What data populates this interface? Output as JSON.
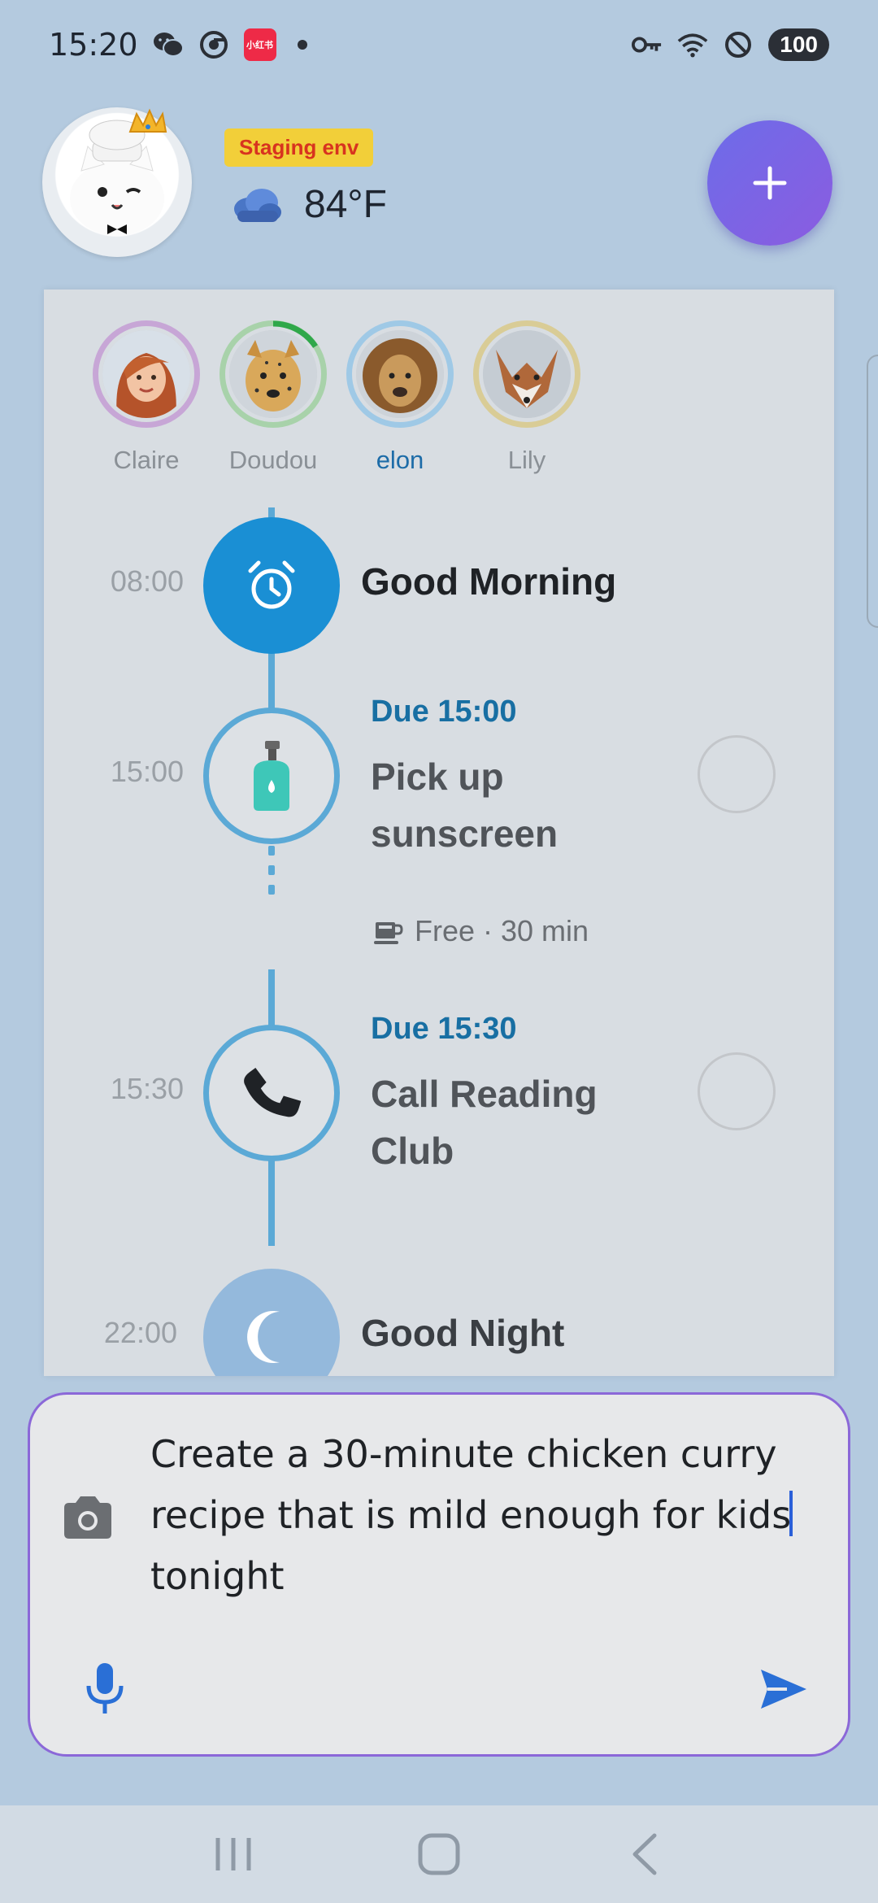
{
  "status_bar": {
    "time": "15:20",
    "battery": "100",
    "notification_icons": [
      "wechat-icon",
      "chrome-icon",
      "xiaohongshu-icon"
    ],
    "xhs_label": "小红书"
  },
  "header": {
    "env_badge": "Staging env",
    "temperature": "84°F",
    "weather_icon": "cloud-icon",
    "add_label": "+"
  },
  "people": [
    {
      "name": "Claire",
      "ring_color": "#c7a6d6",
      "active": false
    },
    {
      "name": "Doudou",
      "ring_color": "#a8d2aa",
      "active": false,
      "progress_arc_color": "#2fa84a"
    },
    {
      "name": "elon",
      "ring_color": "#9fc9e6",
      "active": true
    },
    {
      "name": "Lily",
      "ring_color": "#d9cc96",
      "active": false
    }
  ],
  "timeline": {
    "morning": {
      "time": "08:00",
      "title": "Good Morning",
      "icon": "alarm-clock-icon"
    },
    "tasks": [
      {
        "time": "15:00",
        "due": "Due 15:00",
        "title": "Pick up sunscreen",
        "icon": "lotion-bottle-icon"
      },
      {
        "time": "15:30",
        "due": "Due 15:30",
        "title": "Call  Reading Club",
        "icon": "phone-icon"
      }
    ],
    "free": {
      "text": "Free · 30 min",
      "icon": "coffee-cup-icon"
    },
    "night": {
      "time": "22:00",
      "title": "Good Night",
      "icon": "moon-icon"
    }
  },
  "composer": {
    "text_before_caret": "Create a 30-minute chicken curry recipe that is mild enough for kids",
    "text_after_caret": "tonight"
  },
  "colors": {
    "accent_blue": "#1a8fd4",
    "timeline_blue": "#5ba9d6",
    "fab_purple": "#7b64e6",
    "composer_border": "#8b68d8"
  }
}
